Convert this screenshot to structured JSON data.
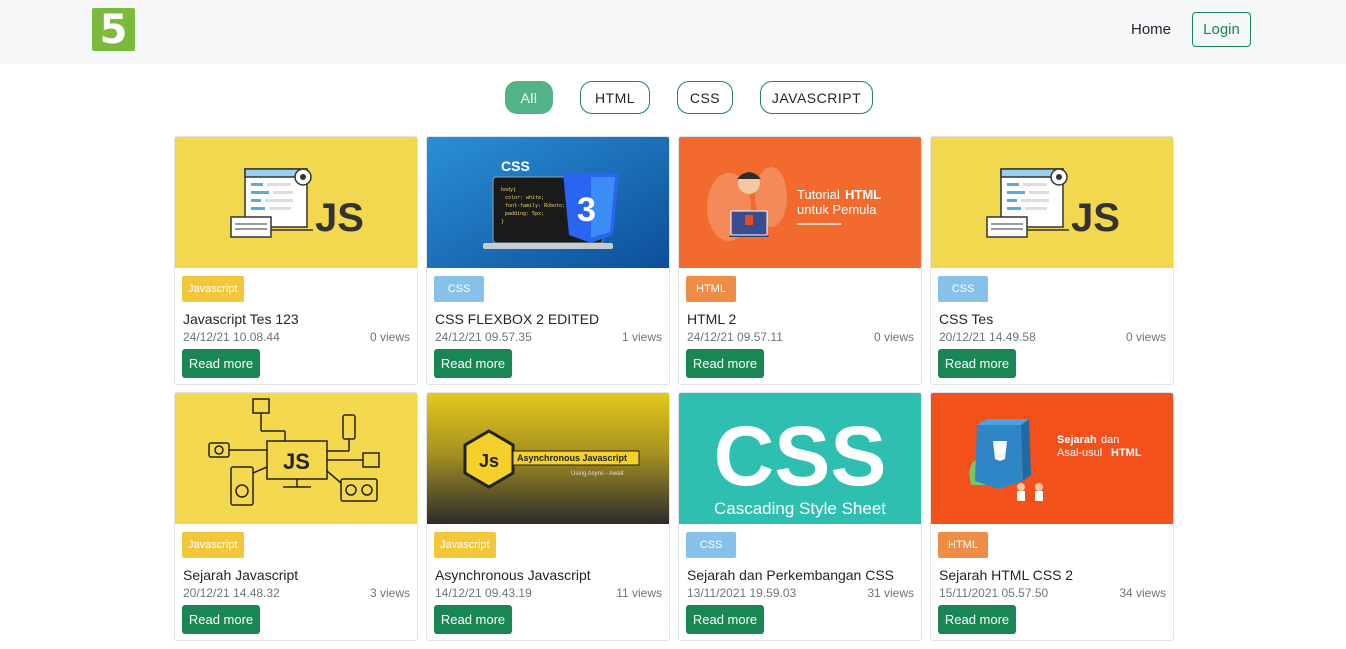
{
  "nav": {
    "logo_text": "5",
    "home_label": "Home",
    "login_label": "Login"
  },
  "filters": [
    {
      "label": "All",
      "active": true
    },
    {
      "label": "HTML",
      "active": false
    },
    {
      "label": "CSS",
      "active": false
    },
    {
      "label": "JAVASCRIPT",
      "active": false
    }
  ],
  "cards": [
    {
      "category": "Javascript",
      "title": "Javascript Tes 123",
      "date": "24/12/21 10.08.44",
      "views": "0 views",
      "read_more": "Read more",
      "image": "js-illustration"
    },
    {
      "category": "CSS",
      "title": "CSS FLEXBOX 2 EDITED",
      "date": "24/12/21 09.57.35",
      "views": "1 views",
      "read_more": "Read more",
      "image": "css3-laptop",
      "image_text": "CSS"
    },
    {
      "category": "HTML",
      "title": "HTML 2",
      "date": "24/12/21 09.57.11",
      "views": "0 views",
      "read_more": "Read more",
      "image": "tutorial-html",
      "image_text_1": "Tutorial",
      "image_text_2": "HTML",
      "image_text_3": "untuk Pemula"
    },
    {
      "category": "CSS",
      "title": "CSS Tes",
      "date": "20/12/21 14.49.58",
      "views": "0 views",
      "read_more": "Read more",
      "image": "js-illustration"
    },
    {
      "category": "Javascript",
      "title": "Sejarah Javascript",
      "date": "20/12/21 14.48.32",
      "views": "3 views",
      "read_more": "Read more",
      "image": "js-devices"
    },
    {
      "category": "Javascript",
      "title": "Asynchronous Javascript",
      "date": "14/12/21 09.43.19",
      "views": "11 views",
      "read_more": "Read more",
      "image": "async-js",
      "image_text_1": "Asynchronous Javascript",
      "image_text_2": "Using Async - Await"
    },
    {
      "category": "CSS",
      "title": "Sejarah dan Perkembangan CSS",
      "date": "13/11/2021 19.59.03",
      "views": "31 views",
      "read_more": "Read more",
      "image": "css-big",
      "image_text_1": "CSS",
      "image_text_2": "Cascading Style Sheet"
    },
    {
      "category": "HTML",
      "title": "Sejarah HTML CSS 2",
      "date": "15/11/2021 05.57.50",
      "views": "34 views",
      "read_more": "Read more",
      "image": "sejarah-html",
      "image_text_1": "Sejarah",
      "image_text_2": "dan",
      "image_text_3": "Asal-usul",
      "image_text_4": "HTML"
    }
  ],
  "colors": {
    "brand_green": "#198754",
    "pill_active": "#52b388",
    "badge_js": "#f2c83a",
    "badge_css": "#87c1ea",
    "badge_html": "#ef8c45",
    "logo": "#7cba3d"
  }
}
